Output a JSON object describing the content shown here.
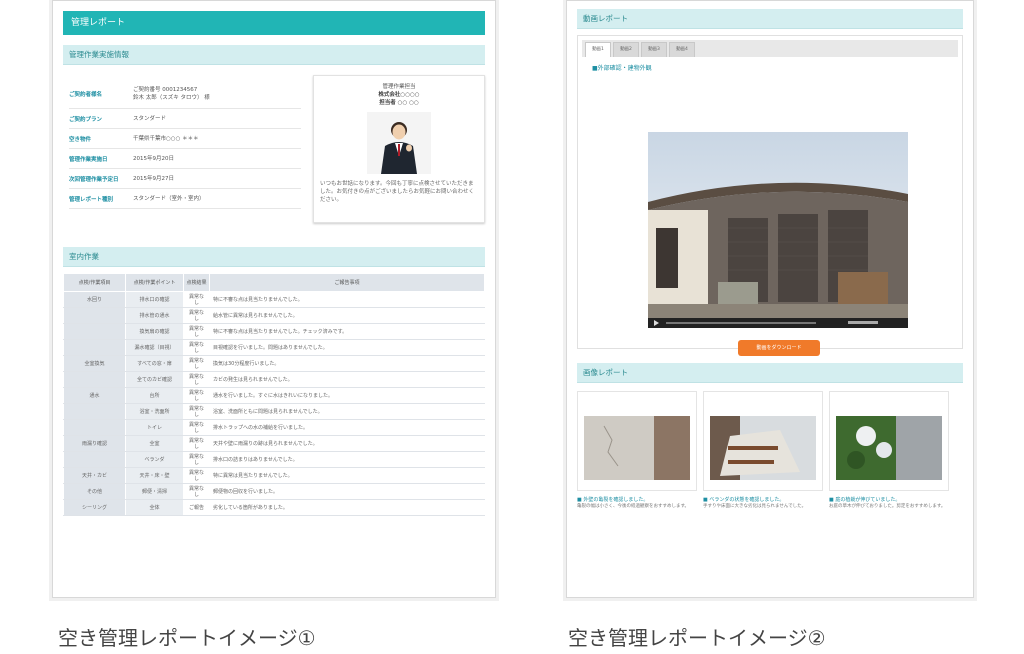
{
  "doc1": {
    "title": "管理レポート",
    "section_info": "管理作業実施情報",
    "info_rows": [
      {
        "k": "ご契約者様名",
        "v": "ご契約番号 0001234567\n鈴木 太郎（スズキ タロウ） 様"
      },
      {
        "k": "ご契約プラン",
        "v": "スタンダード"
      },
      {
        "k": "空き物件",
        "v": "千葉県千葉市○○○ ＊＊＊"
      },
      {
        "k": "管理作業実施日",
        "v": "2015年9月20日"
      },
      {
        "k": "次回管理作業予定日",
        "v": "2015年9月27日"
      },
      {
        "k": "管理レポート種別",
        "v": "スタンダード（室外・室内）"
      }
    ],
    "profile": {
      "company": "管理作業担当",
      "shop": "株式会社○○○○",
      "person": "担当者 ○○ ○○",
      "message": "いつもお世話になります。今回も丁寧に点検させていただきました。お気付きの点がございましたらお気軽にお問い合わせください。"
    },
    "section_room": "室内作業",
    "table_headers": [
      "点検/作業項目",
      "点検/作業ポイント",
      "点検結果",
      "ご報告事項"
    ],
    "rows": [
      {
        "grp": "水回り",
        "sub": "排水口の確認",
        "st": "異常なし",
        "note": "特に不審な点は見当たりませんでした。"
      },
      {
        "grp": "",
        "sub": "排水管の通水",
        "st": "異常なし",
        "note": "給水管に異常は見られませんでした。"
      },
      {
        "grp": "",
        "sub": "換気扇の確認",
        "st": "異常なし",
        "note": "特に不審な点は見当たりませんでした。チェック済みです。"
      },
      {
        "grp": "",
        "sub": "漏水確認（目視）",
        "st": "異常なし",
        "note": "目視確認を行いました。問題はありませんでした。"
      },
      {
        "grp": "全室換気",
        "sub": "すべての窓・扉",
        "st": "異常なし",
        "note": "換気は30分程度行いました。"
      },
      {
        "grp": "",
        "sub": "全てのカビ確認",
        "st": "異常なし",
        "note": "カビの発生は見られませんでした。"
      },
      {
        "grp": "通水",
        "sub": "台所",
        "st": "異常なし",
        "note": "通水を行いました。すぐに水はきれいになりました。"
      },
      {
        "grp": "",
        "sub": "浴室・洗面所",
        "st": "異常なし",
        "note": "浴室、洗面所ともに問題は見られませんでした。"
      },
      {
        "grp": "",
        "sub": "トイレ",
        "st": "異常なし",
        "note": "排水トラップへの水の補給を行いました。"
      },
      {
        "grp": "雨漏り確認",
        "sub": "全室",
        "st": "異常なし",
        "note": "天井や壁に雨漏りの跡は見られませんでした。"
      },
      {
        "grp": "",
        "sub": "ベランダ",
        "st": "異常なし",
        "note": "排水口の詰まりはありませんでした。"
      },
      {
        "grp": "天井・カビ",
        "sub": "天井・床・壁",
        "st": "異常なし",
        "note": "特に異常は見当たりませんでした。"
      },
      {
        "grp": "その他",
        "sub": "郵便・清掃",
        "st": "異常なし",
        "note": "郵便物の回収を行いました。"
      },
      {
        "grp": "シーリング",
        "sub": "全体",
        "st": "ご報告",
        "note": "劣化している箇所がありました。"
      }
    ]
  },
  "doc2": {
    "section_video": "動画レポート",
    "tabs": [
      "動画1",
      "動画2",
      "動画3",
      "動画4"
    ],
    "video_link": "■外部確認・建物外観",
    "download": "動画をダウンロード",
    "section_photo": "画像レポート",
    "photos": [
      {
        "cap": "■ 外壁の亀裂を確認しました。",
        "note": "亀裂の幅は小さく、今後の経過観察をおすすめします。"
      },
      {
        "cap": "■ ベランダの状態を確認しました。",
        "note": "手すりや床面に大きな劣化は見られませんでした。"
      },
      {
        "cap": "■ 庭の植栽が伸びていました。",
        "note": "お庭の草木が伸びておりました。剪定をおすすめします。"
      }
    ]
  },
  "captions": {
    "left": "空き管理レポートイメージ①",
    "right": "空き管理レポートイメージ②"
  }
}
